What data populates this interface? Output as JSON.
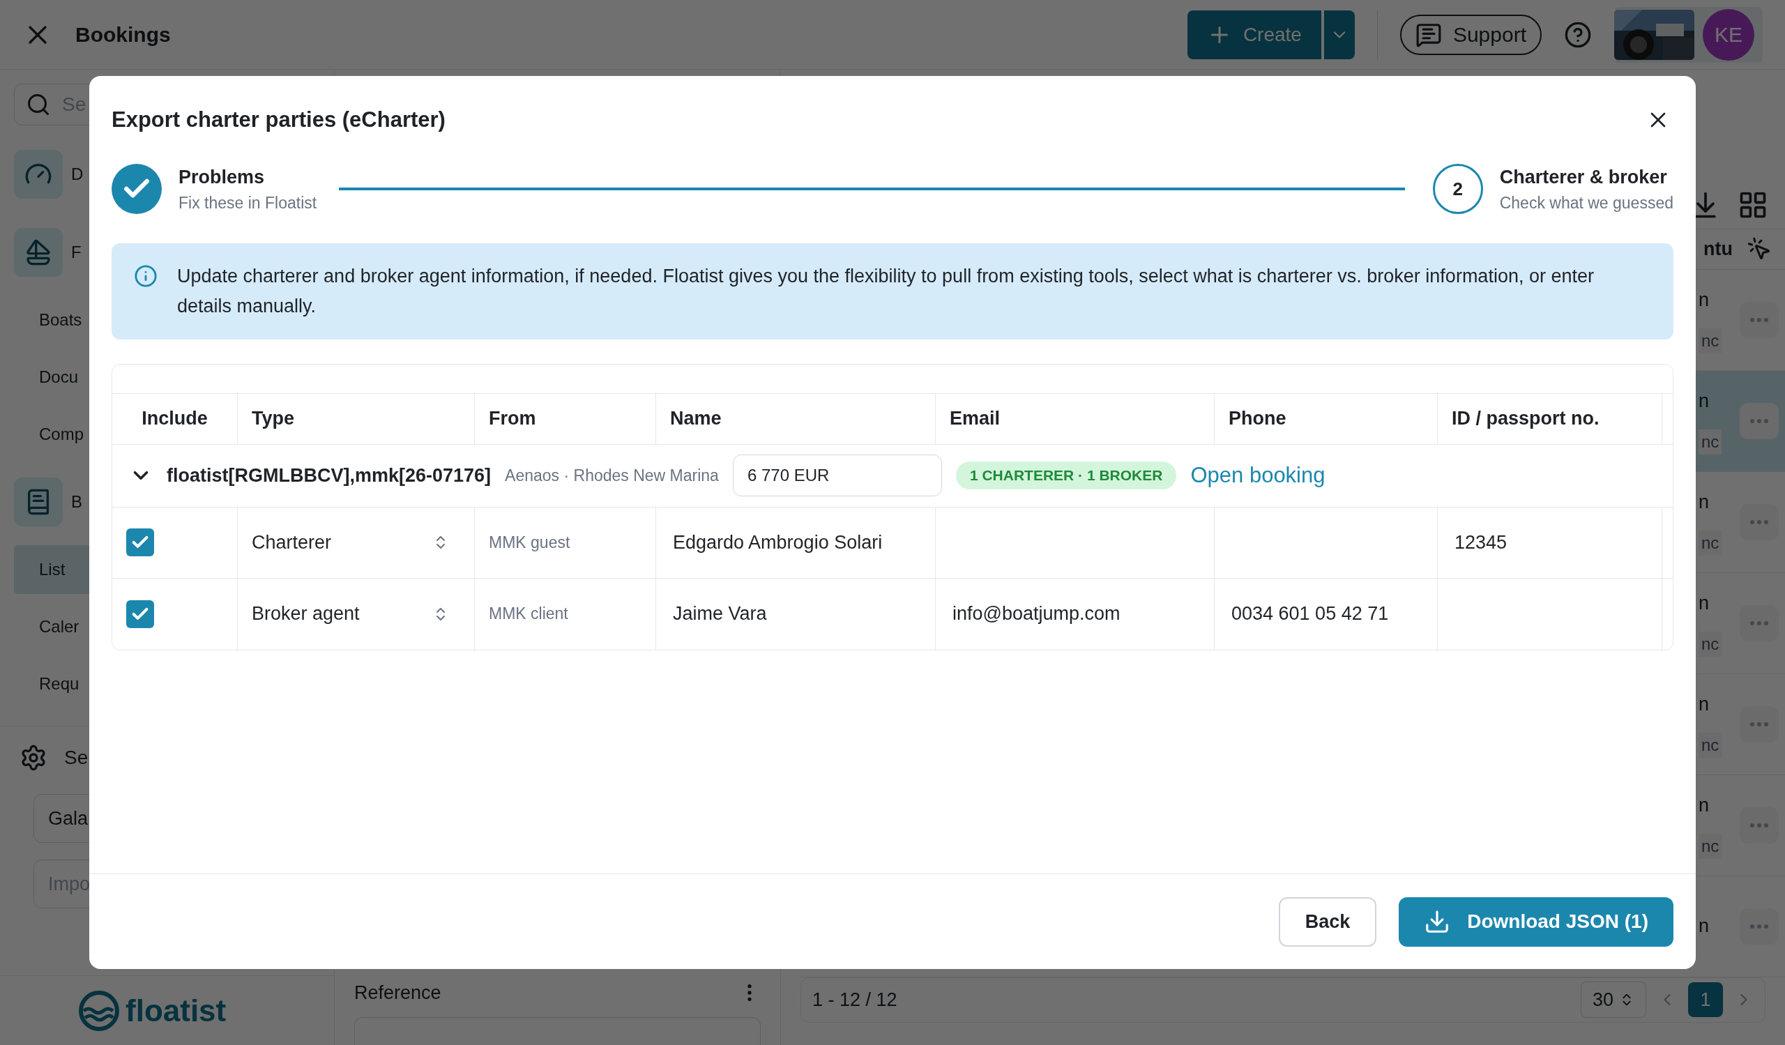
{
  "app_bar": {
    "title": "Bookings",
    "create_button": "Create",
    "support_button": "Support",
    "avatar": "KE"
  },
  "sidebar": {
    "search_placeholder": "Se",
    "items": [
      {
        "kind": "gauge",
        "label": "D",
        "selected": false
      },
      {
        "kind": "sailboat",
        "label": "F",
        "selected": false
      },
      {
        "kind": "link",
        "label": "Boats",
        "selected": false
      },
      {
        "kind": "link",
        "label": "Docu",
        "selected": false
      },
      {
        "kind": "link",
        "label": "Comp",
        "selected": false
      },
      {
        "kind": "book",
        "label": "B",
        "selected": false
      },
      {
        "kind": "link",
        "label": "List",
        "selected": true
      },
      {
        "kind": "link",
        "label": "Caler",
        "selected": false
      },
      {
        "kind": "link",
        "label": "Requ",
        "selected": false
      }
    ],
    "settings": "Se",
    "company_field": {
      "value": "Gala"
    },
    "import_field": {
      "placeholder": "Impo"
    },
    "logo": "floatist"
  },
  "middle_panel": {
    "column_header": "Reference"
  },
  "right_panel": {
    "header_fragment": "ntu",
    "rows": [
      {
        "cell": "n",
        "tag": "nc",
        "selected": false
      },
      {
        "cell": "n",
        "tag": "nc",
        "selected": true
      },
      {
        "cell": "n",
        "tag": "nc",
        "selected": false
      },
      {
        "cell": "n",
        "tag": "nc",
        "selected": false
      },
      {
        "cell": "n",
        "tag": "nc",
        "selected": false
      },
      {
        "cell": "n",
        "tag": "nc",
        "selected": false
      },
      {
        "cell": "n",
        "selected": false
      }
    ],
    "pagination": {
      "range": "1 - 12 / 12",
      "page_size": "30",
      "pages": [
        {
          "label": "1",
          "selected": true
        }
      ]
    }
  },
  "dialog": {
    "title": "Export charter parties (eCharter)",
    "steps": [
      {
        "title": "Problems",
        "subtitle": "Fix these in Floatist",
        "done": true
      },
      {
        "number": "2",
        "title": "Charterer & broker",
        "subtitle": "Check what we guessed",
        "done": false
      }
    ],
    "info": "Update charterer and broker agent information, if needed. Floatist gives you the flexibility to pull from existing tools, select what is charterer vs. broker information, or enter details manually.",
    "table": {
      "columns": [
        "Include",
        "Type",
        "From",
        "Name",
        "Email",
        "Phone",
        "ID / passport no."
      ],
      "group": {
        "expanded": true,
        "reference": "floatist[RGMLBBCV],mmk[26-07176]",
        "location": "Aenaos · Rhodes New Marina",
        "amount": "6 770 EUR",
        "badge": "1 CHARTERER · 1 BROKER",
        "link": "Open booking"
      },
      "rows": [
        {
          "checked": true,
          "type": "Charterer",
          "from": "MMK guest",
          "name": "Edgardo Ambrogio Solari",
          "id": "12345"
        },
        {
          "checked": true,
          "type": "Broker agent",
          "from": "MMK client",
          "name": "Jaime Vara",
          "email": "info@boatjump.com",
          "phone": "0034 601 05 42 71"
        }
      ]
    },
    "buttons": {
      "back": "Back",
      "download": "Download JSON (1)"
    }
  }
}
